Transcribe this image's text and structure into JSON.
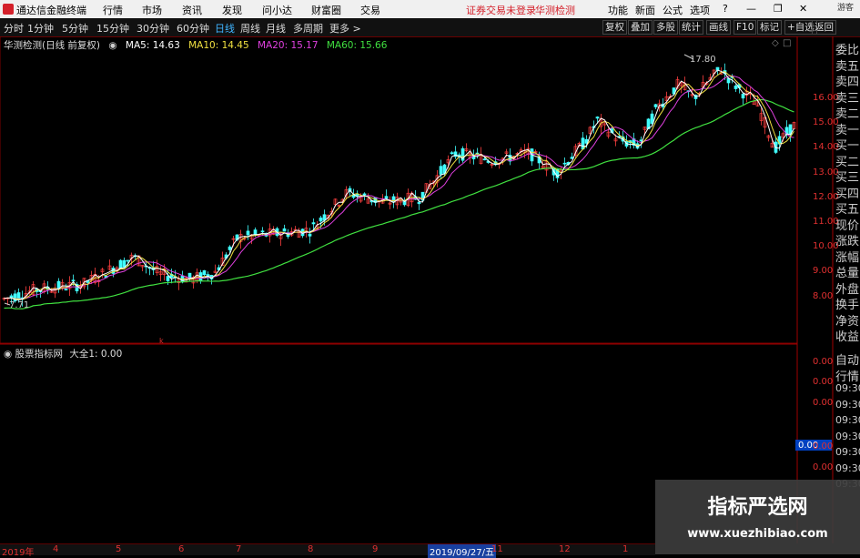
{
  "menu": {
    "app_title": "通达信金融终端",
    "items": [
      "行情",
      "市场",
      "资讯",
      "发现",
      "问小达",
      "财富圈",
      "交易"
    ],
    "alert": "证券交易未登录",
    "alert2": "华测检测",
    "right": [
      "功能",
      "新面",
      "公式",
      "选项"
    ],
    "user": "游客"
  },
  "toolbar": {
    "periods": [
      "分时",
      "1分钟",
      "5分钟",
      "15分钟",
      "30分钟",
      "60分钟",
      "日线",
      "周线",
      "月线",
      "多周期",
      "更多 >"
    ],
    "active": "日线",
    "buttons": [
      "复权",
      "叠加",
      "多股",
      "统计",
      "画线",
      "F10",
      "标记",
      "+自选",
      "返回"
    ]
  },
  "legend": {
    "name": "华测检测(日线 前复权)",
    "ma5": "MA5: 14.63",
    "ma10": "MA10: 14.45",
    "ma20": "MA20: 15.17",
    "ma60": "MA60: 15.66"
  },
  "annotations": {
    "high": "17.80",
    "low": "7.71"
  },
  "price_axis": [
    "16.00",
    "15.00",
    "14.00",
    "13.00",
    "12.00",
    "11.00",
    "10.00",
    "9.00",
    "8.00"
  ],
  "sub": {
    "legend": "股票指标网",
    "value": "大全1: 0.00",
    "axis": [
      "0.00",
      "0.00",
      "0.00",
      "0.00",
      "0.00"
    ],
    "highlight": "0.00"
  },
  "quote_panel": [
    "委比",
    "卖五",
    "卖四",
    "卖三",
    "卖二",
    "卖一",
    "买一",
    "买二",
    "买三",
    "买四",
    "买五",
    "现价",
    "涨跌",
    "涨幅",
    "总量",
    "外盘",
    "换手",
    "净资",
    "收益"
  ],
  "auto_panel": [
    "自动",
    "行情",
    "09:30",
    "09:30",
    "09:30",
    "09:30",
    "09:30",
    "09:30",
    "09:30"
  ],
  "dates": {
    "start": "2019年",
    "months": [
      "4",
      "5",
      "6",
      "7",
      "8",
      "9",
      "11",
      "12"
    ],
    "cursor": "2019/09/27/五",
    "last": "1"
  },
  "watermark": {
    "title": "指标严选网",
    "url": "www.xuezhibiao.com"
  },
  "colors": {
    "ma5": "#ffffff",
    "ma10": "#f0e040",
    "ma20": "#e040e0",
    "ma60": "#40e040",
    "up": "#ff4040",
    "down": "#40ffff"
  }
}
